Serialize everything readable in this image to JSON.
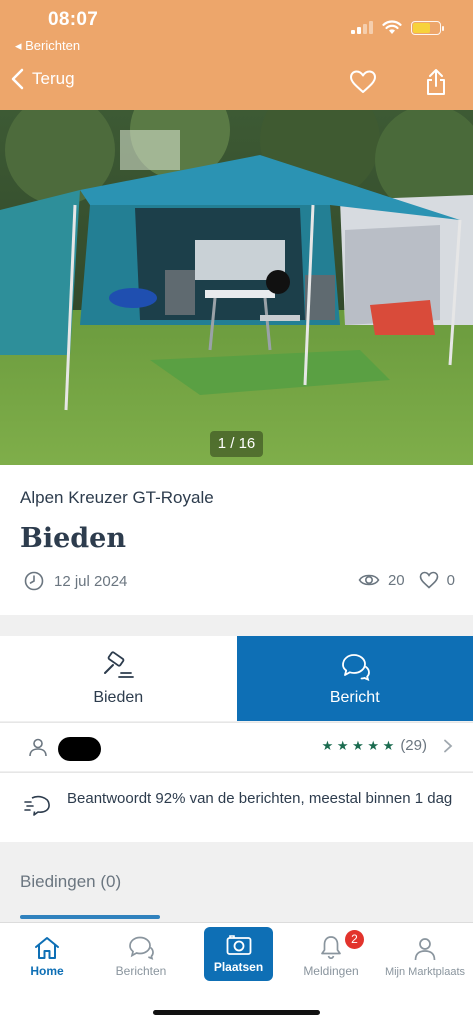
{
  "status": {
    "time": "08:07",
    "back_app": "◂ Berichten"
  },
  "nav": {
    "back_label": "Terug"
  },
  "photo": {
    "counter": "1 / 16"
  },
  "listing": {
    "title": "Alpen Kreuzer GT-Royale",
    "price": "Bieden",
    "date": "12 jul 2024",
    "views": "20",
    "favorites": "0"
  },
  "actions": {
    "bid_label": "Bieden",
    "message_label": "Bericht"
  },
  "seller": {
    "rating_count": "(29)",
    "stars": "★ ★ ★ ★ ★"
  },
  "response": {
    "text": "Beantwoordt 92% van de berichten, meestal binnen 1 dag"
  },
  "bids": {
    "label": "Biedingen (0)"
  },
  "tabbar": {
    "home": "Home",
    "messages": "Berichten",
    "post": "Plaatsen",
    "notifications": "Meldingen",
    "notifications_badge": "2",
    "account": "Mijn Marktplaats"
  },
  "colors": {
    "header": "#eda66b",
    "primary": "#0e6fb5",
    "star": "#1a6b4f",
    "badge": "#e2332c"
  }
}
